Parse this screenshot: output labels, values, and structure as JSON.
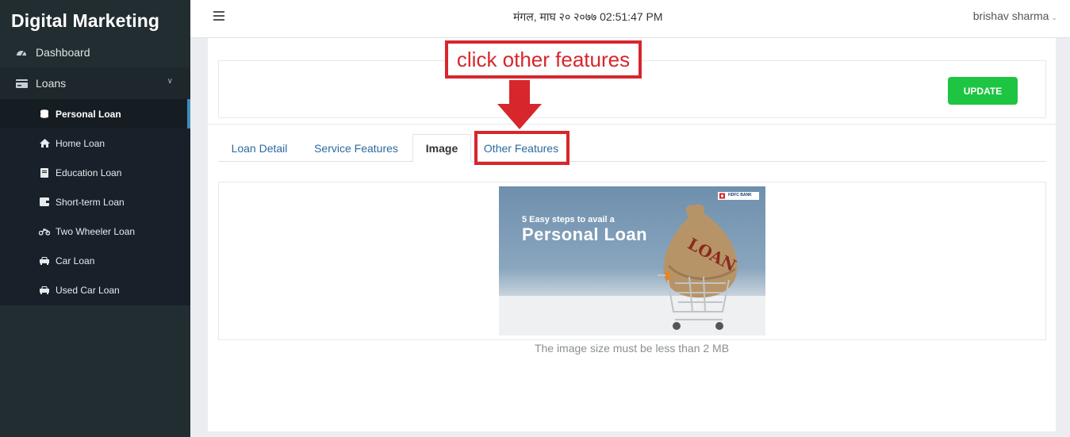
{
  "sidebar": {
    "brand": "Digital Marketing",
    "dashboard": {
      "label": "Dashboard",
      "icon": "dashboard-gauge-icon"
    },
    "loans": {
      "label": "Loans",
      "icon": "credit-card-icon"
    },
    "items": [
      {
        "label": "Personal Loan",
        "icon": "coins-icon",
        "active": true
      },
      {
        "label": "Home Loan",
        "icon": "home-icon"
      },
      {
        "label": "Education Loan",
        "icon": "book-icon"
      },
      {
        "label": "Short-term Loan",
        "icon": "wallet-icon"
      },
      {
        "label": "Two Wheeler Loan",
        "icon": "motorcycle-icon"
      },
      {
        "label": "Car Loan",
        "icon": "car-icon"
      },
      {
        "label": "Used Car Loan",
        "icon": "car-icon"
      }
    ]
  },
  "header": {
    "datetime": "मंगल, माघ २० २०७७ 02:51:47 PM",
    "user": "brishav sharma"
  },
  "main": {
    "update_label": "UPDATE",
    "tabs": [
      {
        "label": "Loan Detail"
      },
      {
        "label": "Service Features"
      },
      {
        "label": "Image",
        "active": true
      },
      {
        "label": "Other Features"
      }
    ],
    "banner": {
      "bank": "HDFC BANK",
      "line1": "5 Easy steps to avail a",
      "line2": "Personal Loan",
      "sack_text": "LOAN"
    },
    "hint": "The image size must be less than 2 MB"
  },
  "annotation": {
    "callout": "click other features",
    "color": "#d7262c"
  },
  "colors": {
    "sidebar_bg": "#222d32",
    "active_indicator": "#3c8dbc",
    "update_button": "#1ec542",
    "tab_link": "#2a6aa0"
  }
}
